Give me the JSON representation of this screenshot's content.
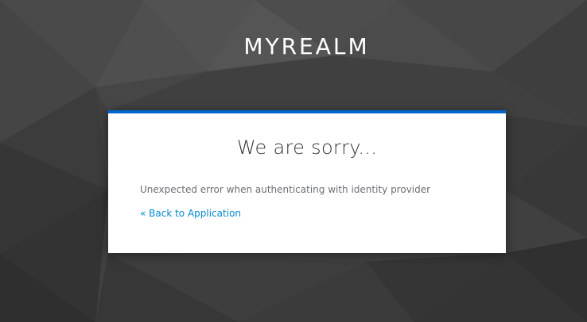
{
  "realm": {
    "title": "MYREALM"
  },
  "card": {
    "title": "We are sorry...",
    "message": "Unexpected error when authenticating with identity provider",
    "back_link": "« Back to Application"
  },
  "colors": {
    "accent": "#0066cc",
    "link": "#0088ce",
    "background": "#3f3f3f",
    "card_background": "#ffffff"
  }
}
